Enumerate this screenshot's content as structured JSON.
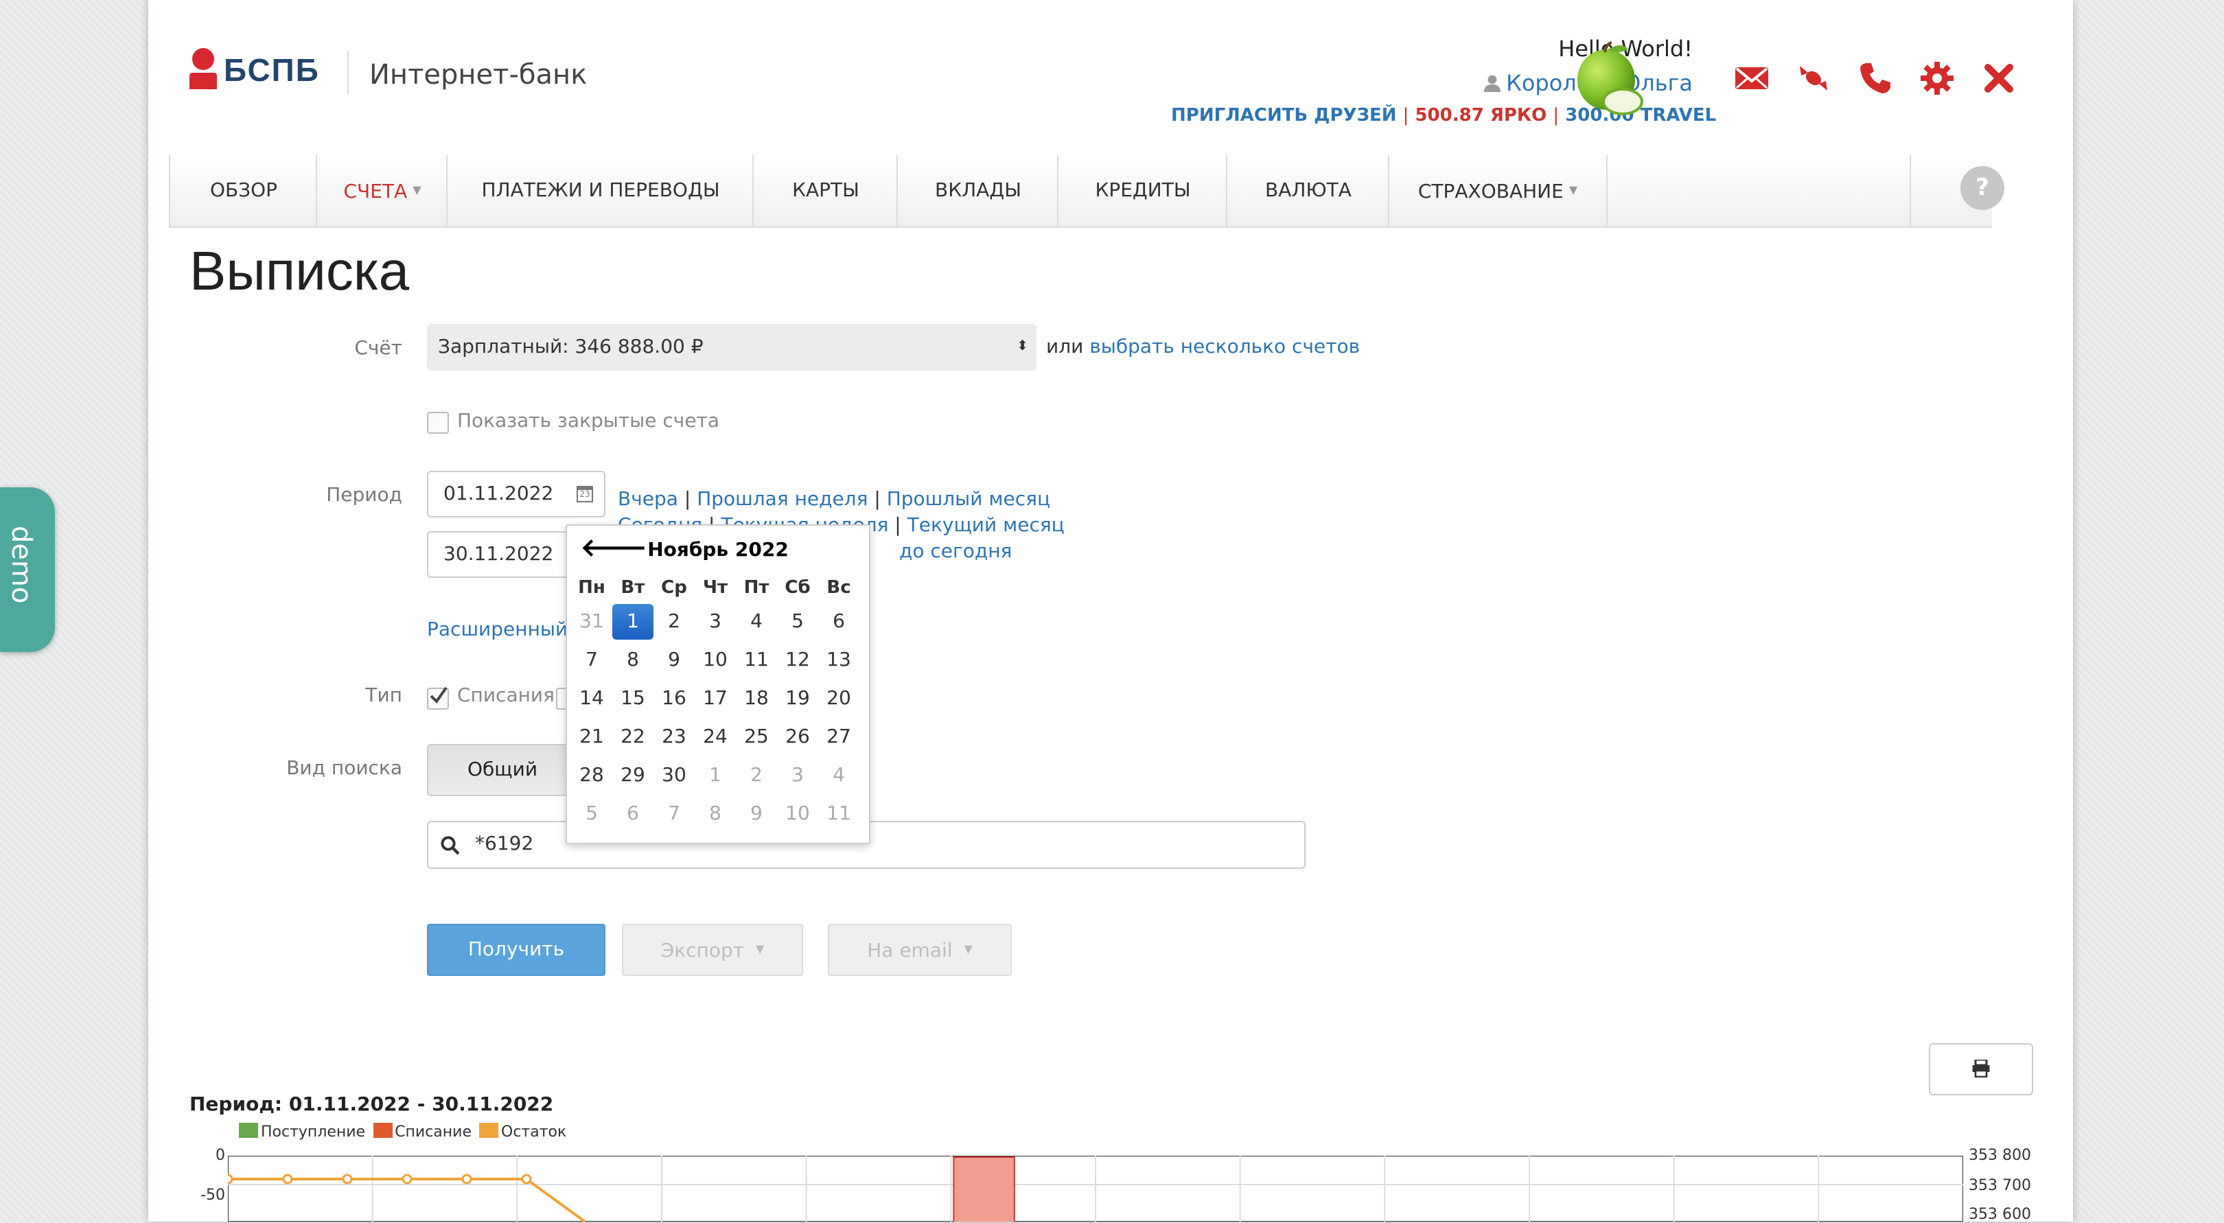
{
  "demo_tab": "demo",
  "header": {
    "brand": "БСПБ",
    "product": "Интернет-банк",
    "greeting": "Hello World!",
    "user_name": "Королёва Ольга",
    "invite_link": "ПРИГЛАСИТЬ ДРУЗЕЙ",
    "separator": "|",
    "bonus_yarko": "500.87 ЯРКО",
    "bonus_travel": "300.00 TRAVEL",
    "icons": [
      "mail-icon",
      "candy-icon",
      "phone-icon",
      "gear-icon",
      "close-icon"
    ]
  },
  "nav": {
    "items": [
      {
        "label": "ОБЗОР"
      },
      {
        "label": "СЧЕТА"
      },
      {
        "label": "ПЛАТЕЖИ И ПЕРЕВОДЫ"
      },
      {
        "label": "КАРТЫ"
      },
      {
        "label": "ВКЛАДЫ"
      },
      {
        "label": "КРЕДИТЫ"
      },
      {
        "label": "ВАЛЮТА"
      },
      {
        "label": "СТРАХОВАНИЕ"
      }
    ],
    "help": "?"
  },
  "page_title": "Выписка",
  "form": {
    "account_label": "Счёт",
    "account_value": "Зарплатный: 346 888.00 ₽",
    "or_text": "или",
    "multi_link": "выбрать несколько счетов",
    "show_closed": "Показать закрытые счета",
    "period_label": "Период",
    "date_from": "01.11.2022",
    "date_to": "30.11.2022",
    "quick": {
      "yesterday": "Вчера",
      "last_week": "Прошлая неделя",
      "last_month": "Прошлый месяц",
      "today_partial": "Сегодня",
      "current_week_partial": "Текущая неделя",
      "current_month": "Текущий месяц",
      "until_today": "до сегодня"
    },
    "advanced_partial": "Расширенный с",
    "type_label": "Тип",
    "type_debit": "Списания",
    "search_type_label": "Вид поиска",
    "search_type_value": "Общий",
    "search_value": "*6192",
    "get_button": "Получить",
    "export_button": "Экспорт",
    "email_button": "На email"
  },
  "calendar": {
    "title": "Ноябрь 2022",
    "dow": [
      "Пн",
      "Вт",
      "Ср",
      "Чт",
      "Пт",
      "Сб",
      "Вс"
    ],
    "weeks": [
      [
        "31",
        "1",
        "2",
        "3",
        "4",
        "5",
        "6"
      ],
      [
        "7",
        "8",
        "9",
        "10",
        "11",
        "12",
        "13"
      ],
      [
        "14",
        "15",
        "16",
        "17",
        "18",
        "19",
        "20"
      ],
      [
        "21",
        "22",
        "23",
        "24",
        "25",
        "26",
        "27"
      ],
      [
        "28",
        "29",
        "30",
        "1",
        "2",
        "3",
        "4"
      ],
      [
        "5",
        "6",
        "7",
        "8",
        "9",
        "10",
        "11"
      ]
    ],
    "selected": "1"
  },
  "chart_data": {
    "type": "line",
    "title": "Период: 01.11.2022 - 30.11.2022",
    "legend": [
      "Поступление",
      "Списание",
      "Остаток"
    ],
    "legend_colors": [
      "#6aa84f",
      "#e0582e",
      "#f0a43a"
    ],
    "y_left_ticks": [
      "0",
      "-50"
    ],
    "y_right_ticks": [
      "353 800",
      "353 700",
      "353 600"
    ],
    "series": [
      {
        "name": "Остаток",
        "values": [
          353720,
          353720,
          353720,
          353720,
          353720,
          353720
        ]
      }
    ]
  }
}
